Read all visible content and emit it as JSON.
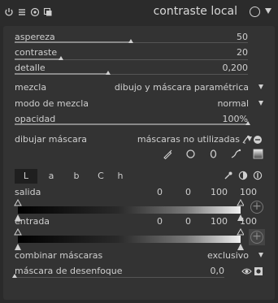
{
  "header": {
    "title": "contraste local",
    "icons": [
      "power-icon",
      "presets-icon",
      "multi-instance-icon",
      "reset-icon"
    ]
  },
  "sliders": [
    {
      "label": "aspereza",
      "value": "50",
      "fraction": 0.5
    },
    {
      "label": "contraste",
      "value": "20",
      "fraction": 0.2
    },
    {
      "label": "detalle",
      "value": "0,200",
      "fraction": 0.4
    }
  ],
  "combos": {
    "mezcla": {
      "label": "mezcla",
      "value": "dibujo y máscara paramétrica"
    },
    "modo": {
      "label": "modo de mezcla",
      "value": "normal"
    }
  },
  "opacidad": {
    "label": "opacidad",
    "value": "100%",
    "fraction": 1.0
  },
  "dibujar": {
    "label": "dibujar máscara",
    "value": "máscaras no utilizadas"
  },
  "channels": {
    "tabs": [
      "L",
      "a",
      "b",
      "C",
      "h"
    ],
    "active": "L"
  },
  "salida": {
    "label": "salida",
    "values": [
      "0",
      "0",
      "100",
      "100"
    ]
  },
  "entrada": {
    "label": "entrada",
    "values": [
      "0",
      "0",
      "100",
      "100"
    ]
  },
  "combinar": {
    "label": "combinar máscaras",
    "value": "exclusivo"
  },
  "desenfoque": {
    "label": "máscara de desenfoque",
    "value": "0,0",
    "fraction": 0.0
  }
}
